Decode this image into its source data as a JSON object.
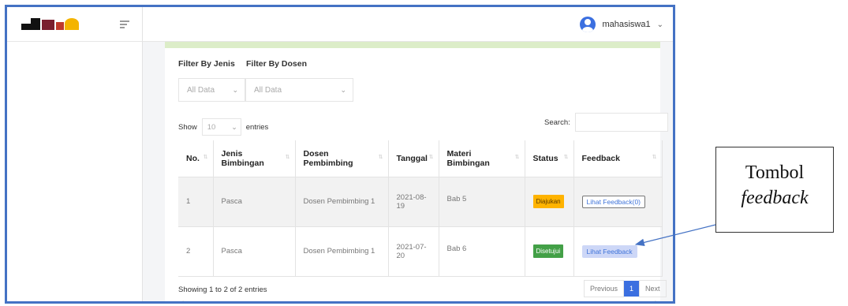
{
  "topbar": {
    "username": "mahasiswa1"
  },
  "filters": {
    "jenis_label": "Filter By Jenis",
    "dosen_label": "Filter By Dosen",
    "jenis_value": "All Data",
    "dosen_value": "All Data"
  },
  "table_controls": {
    "show_label": "Show",
    "entries_value": "10",
    "entries_label": "entries",
    "search_label": "Search:"
  },
  "table": {
    "headers": [
      "No.",
      "Jenis Bimbingan",
      "Dosen Pembimbing",
      "Tanggal",
      "Materi Bimbingan",
      "Status",
      "Feedback"
    ],
    "rows": [
      {
        "no": "1",
        "jenis": "Pasca",
        "dosen": "Dosen Pembimbing 1",
        "tanggal": "2021-08-19",
        "materi": "Bab 5",
        "status": "Diajukan",
        "status_color": "#ffb300",
        "feedback": "Lihat Feedback(0)"
      },
      {
        "no": "2",
        "jenis": "Pasca",
        "dosen": "Dosen Pembimbing 1",
        "tanggal": "2021-07-20",
        "materi": "Bab 6",
        "status": "Disetujui",
        "status_color": "#43a047",
        "feedback": "Lihat Feedback"
      }
    ]
  },
  "footer": {
    "info": "Showing 1 to 2 of 2 entries",
    "previous": "Previous",
    "page": "1",
    "next": "Next"
  },
  "callout": {
    "line1": "Tombol",
    "line2": "feedback"
  },
  "colors": {
    "frame_border": "#4472c4",
    "primary": "#3b6fe0",
    "green_bar": "#dcedc8"
  }
}
